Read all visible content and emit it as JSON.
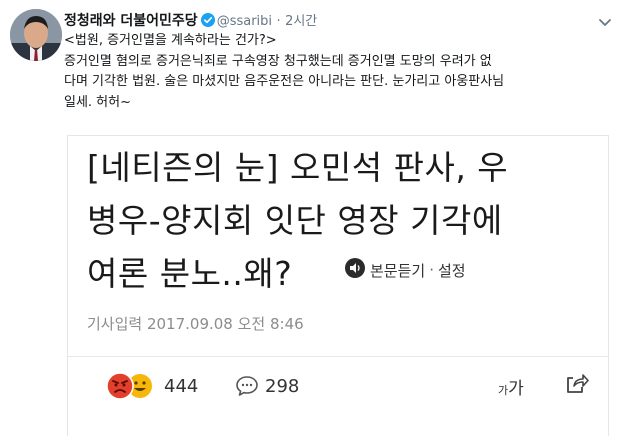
{
  "tweet": {
    "author_name": "정청래와 더불어민주당",
    "handle": "@ssaribi",
    "separator": "·",
    "time": "2시간",
    "text_lines": [
      "<법원, 증거인멸을 계속하라는 건가?>",
      "증거인멸 혐의로 증거은닉죄로 구속영장 청구했는데 증거인멸 도망의 우려가 없",
      "다며 기각한 법원. 술은 마셨지만 음주운전은 아니라는 판단. 눈가리고 아웅판사님",
      "일세. 허허~"
    ]
  },
  "card": {
    "headline_lines": [
      "[네티즌의 눈] 오민석 판사, 우",
      "병우-양지회 잇단 영장 기각에",
      "여론 분노..왜?"
    ],
    "listen_label": "본문듣기",
    "listen_sep": "·",
    "settings_label": "설정",
    "meta": "기사입력  2017.09.08 오전 8:46",
    "reaction_count": "444",
    "comment_count": "298",
    "font_small": "가",
    "font_large": "가"
  },
  "colors": {
    "verified": "#1da1f2",
    "muted": "#657786",
    "angry": "#e2402d",
    "happy": "#f5b80a"
  }
}
